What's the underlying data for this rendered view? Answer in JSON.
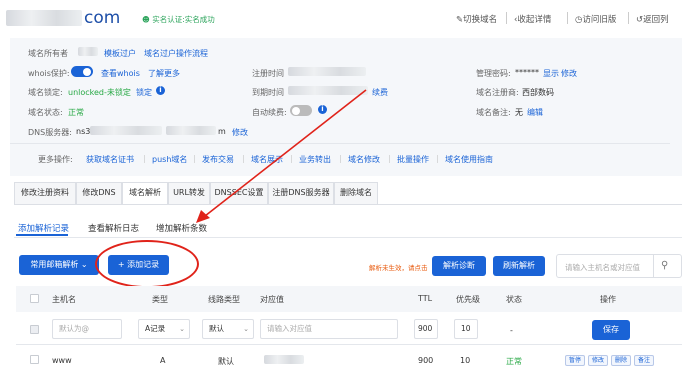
{
  "header": {
    "domain_suffix": "com",
    "verified_text": "实名认证:实名成功",
    "links": [
      "切换域名",
      "收起详情",
      "访问旧版",
      "返回列"
    ]
  },
  "info": {
    "owner_label": "域名所有者",
    "owner_links": [
      "模板过户",
      "域名过户操作流程"
    ],
    "whois_label": "whois保护:",
    "whois_links": [
      "查看whois",
      "了解更多"
    ],
    "lock_label": "域名锁定:",
    "lock_value": "unlocked-未锁定",
    "lock_link": "锁定",
    "status_label": "域名状态:",
    "status_value": "正常",
    "dns_label": "DNS服务器:",
    "dns_prefix": "ns3.",
    "dns_suffix": "m",
    "dns_edit": "修改",
    "reg_time_label": "注册时间",
    "expire_label": "到期时间",
    "renew_link": "续费",
    "auto_renew_label": "自动续费:",
    "pwd_label": "管理密码:",
    "pwd_value": "******",
    "pwd_links": [
      "显示",
      "修改"
    ],
    "registrar_label": "域名注册商:",
    "registrar_value": "西部数码",
    "remark_label": "域名备注:",
    "remark_value": "无",
    "remark_edit": "编辑"
  },
  "more_ops": {
    "label": "更多操作:",
    "items": [
      "获取域名证书",
      "push域名",
      "发布交易",
      "域名展示",
      "业务转出",
      "域名修改",
      "批量操作",
      "域名使用指南"
    ]
  },
  "tabs": [
    "修改注册资料",
    "修改DNS",
    "域名解析",
    "URL转发",
    "DNSSEC设置",
    "注册DNS服务器",
    "删除域名"
  ],
  "active_tab": "域名解析",
  "subtabs": [
    "添加解析记录",
    "查看解析日志",
    "增加解析条数"
  ],
  "toolbar": {
    "mailbox_btn": "常用邮箱解析",
    "add_btn": "+ 添加记录",
    "hint": "解析未生效，请点击",
    "diagnose_btn": "解析诊断",
    "refresh_btn": "刷新解析",
    "search_placeholder": "请输入主机名或对应值"
  },
  "table": {
    "headers": [
      "主机名",
      "类型",
      "线路类型",
      "对应值",
      "TTL",
      "优先级",
      "状态",
      "操作"
    ],
    "new_row": {
      "host_placeholder": "默认为@",
      "type": "A记录",
      "line": "默认",
      "value_placeholder": "请输入对应值",
      "ttl": "900",
      "priority": "10",
      "status": "-",
      "save_btn": "保存"
    },
    "rows": [
      {
        "host": "www",
        "type": "A",
        "line": "默认",
        "ttl": "900",
        "priority": "10",
        "status": "正常",
        "actions": [
          "暂停",
          "修改",
          "删除",
          "备注"
        ]
      }
    ]
  },
  "colors": {
    "accent": "#1a63d6",
    "success": "#27a844",
    "annotation": "#e0231a",
    "hint": "#e8590c"
  }
}
